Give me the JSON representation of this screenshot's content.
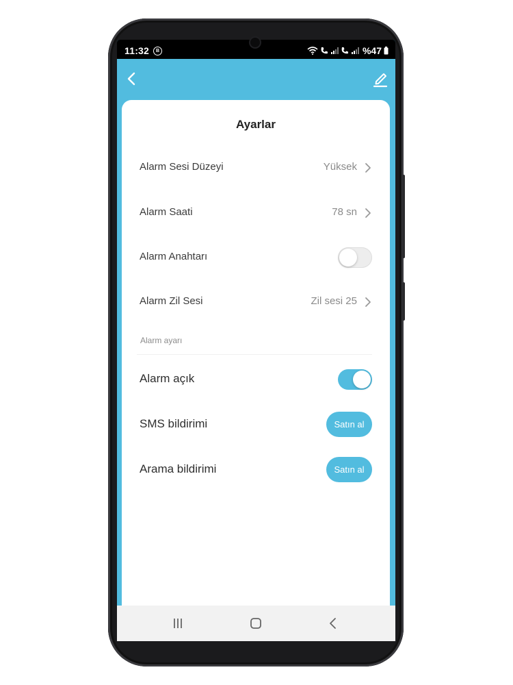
{
  "status_bar": {
    "time": "11:32",
    "badge": "B",
    "battery_text": "%47",
    "icons": [
      "wifi-icon",
      "volte-call-icon",
      "signal-icon",
      "volte-call-icon",
      "signal-icon",
      "battery-icon"
    ]
  },
  "header": {
    "back_icon": "chevron-left-icon",
    "edit_icon": "pencil-icon"
  },
  "settings": {
    "title": "Ayarlar",
    "rows": [
      {
        "label": "Alarm Sesi Düzeyi",
        "value": "Yüksek"
      },
      {
        "label": "Alarm Saati",
        "value": "78 sn"
      },
      {
        "label": "Alarm Anahtarı",
        "toggle_on": false
      },
      {
        "label": "Alarm Zil Sesi",
        "value": "Zil sesi 25"
      }
    ],
    "section_title": "Alarm ayarı",
    "alarm_rows": [
      {
        "label": "Alarm açık",
        "toggle_on": true
      },
      {
        "label": "SMS bildirimi",
        "button": "Satın al"
      },
      {
        "label": "Arama bildirimi",
        "button": "Satın al"
      }
    ]
  },
  "colors": {
    "accent": "#52bcdf",
    "header_bg": "#52bcdf",
    "card_bg": "#ffffff",
    "nav_bg": "#f2f2f2"
  },
  "nav_bar": {
    "icons": [
      "recent-apps-icon",
      "home-icon",
      "back-icon"
    ]
  }
}
